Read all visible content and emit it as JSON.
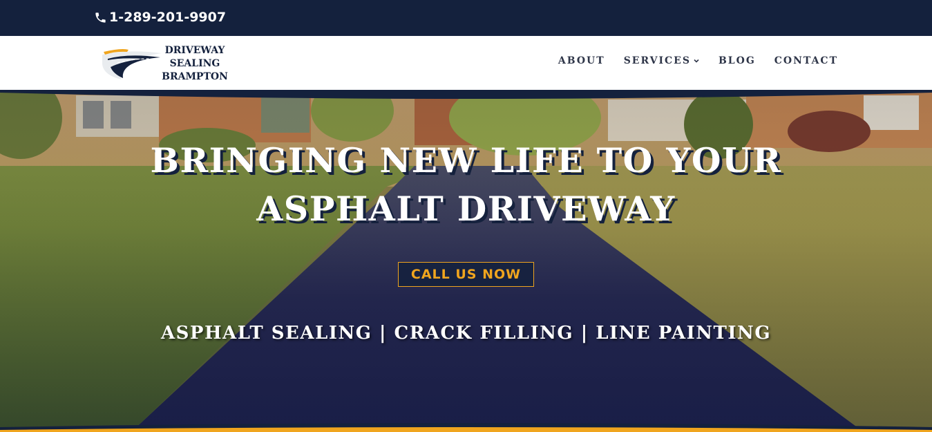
{
  "topbar": {
    "phone_icon": "phone-icon",
    "phone": "1-289-201-9907"
  },
  "logo": {
    "line1": "DRIVEWAY",
    "line2": "SEALING",
    "line3": "BRAMPTON"
  },
  "nav": {
    "items": [
      {
        "label": "ABOUT"
      },
      {
        "label": "SERVICES",
        "icon": "chevron-down-icon"
      },
      {
        "label": "BLOG"
      },
      {
        "label": "CONTACT"
      }
    ]
  },
  "hero": {
    "headline_line1": "BRINGING NEW LIFE TO YOUR",
    "headline_line2": "ASPHALT DRIVEWAY",
    "cta_label": "CALL US NOW",
    "services": "ASPHALT SEALING | CRACK FILLING | LINE PAINTING"
  },
  "colors": {
    "navy": "#14213d",
    "accent": "#f0a51e",
    "nav_text": "#2e3548",
    "white": "#ffffff"
  }
}
